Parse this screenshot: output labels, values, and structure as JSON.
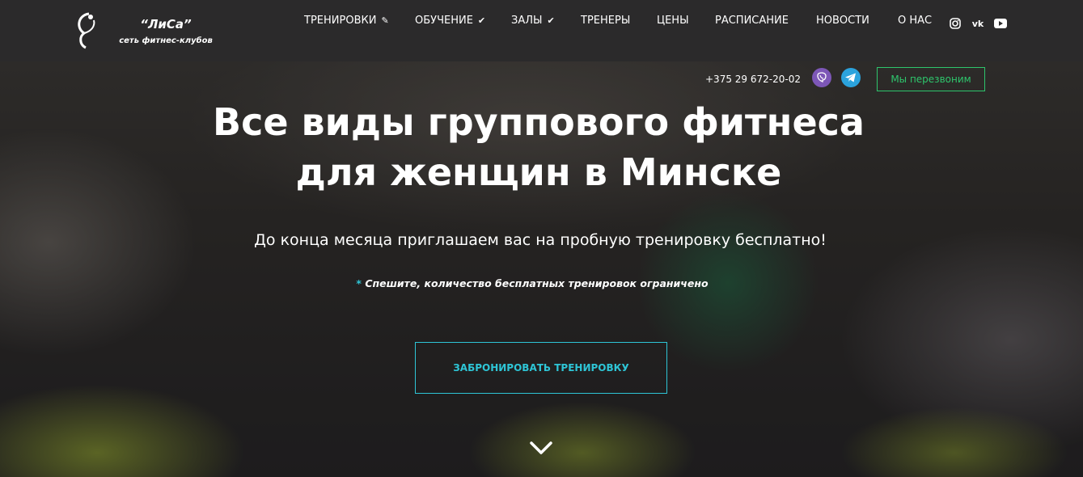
{
  "brand": {
    "name": "“ЛиСа”",
    "tagline": "сеть фитнес-клубов"
  },
  "nav": {
    "items": [
      {
        "label": "ТРЕНИРОВКИ",
        "icon": "pencil-icon"
      },
      {
        "label": "ОБУЧЕНИЕ",
        "icon": "check-icon"
      },
      {
        "label": "ЗАЛЫ",
        "icon": "check-icon"
      },
      {
        "label": "ТРЕНЕРЫ"
      },
      {
        "label": "ЦЕНЫ"
      },
      {
        "label": "РАСПИСАНИЕ"
      },
      {
        "label": "НОВОСТИ"
      },
      {
        "label": "О НАС"
      }
    ],
    "social": [
      {
        "name": "instagram-icon",
        "glyph": "◎"
      },
      {
        "name": "vk-icon",
        "glyph": "vk"
      },
      {
        "name": "youtube-icon",
        "glyph": "▶"
      }
    ]
  },
  "contact": {
    "phone": "+375 29 672-20-02",
    "callback_label": "Мы перезвоним"
  },
  "hero": {
    "title": "Все виды группового фитнеса\nдля женщин в Минске",
    "subtitle": "До конца месяца приглашаем вас на пробную тренировку бесплатно!",
    "note_star": "*",
    "note": "Спешите, количество бесплатных тренировок ограничено",
    "cta_label": "ЗАБРОНИРОВАТЬ ТРЕНИРОВКУ"
  },
  "colors": {
    "header_bg": "#2b2a2b",
    "accent_cyan": "#2ec5d6",
    "accent_green": "#2ec56c",
    "viber": "#7d57b7",
    "telegram": "#2ba3dd"
  }
}
